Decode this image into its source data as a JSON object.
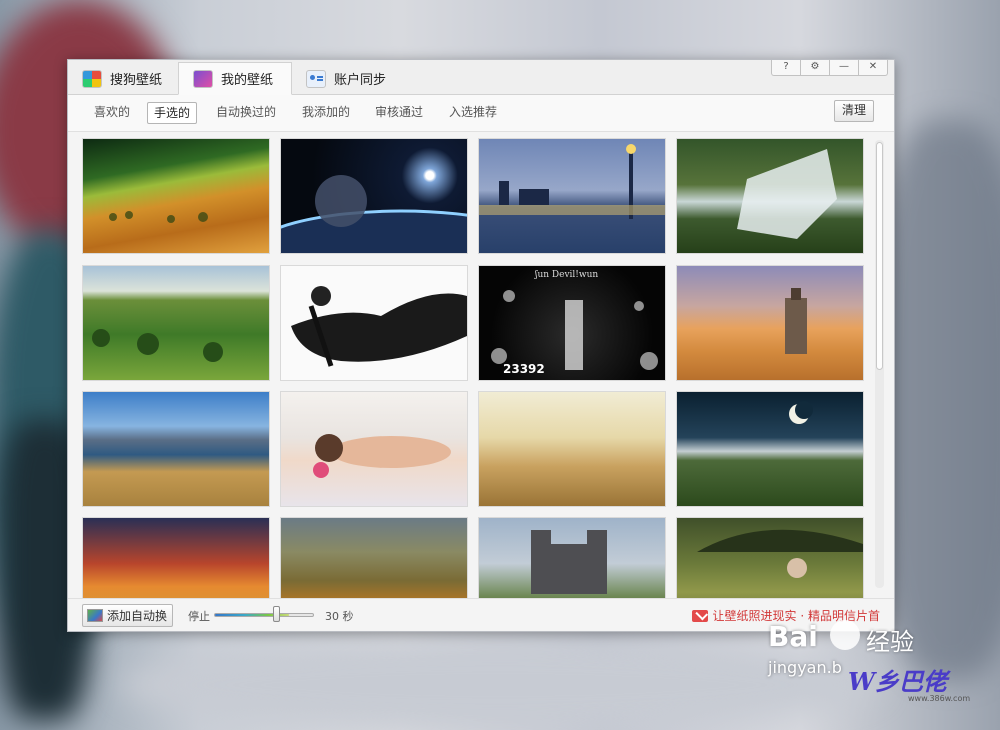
{
  "window": {
    "tabs": [
      {
        "label": "搜狗壁纸",
        "icon": "sogou-logo-icon",
        "active": false
      },
      {
        "label": "我的壁纸",
        "icon": "my-wallpaper-icon",
        "active": true
      },
      {
        "label": "账户同步",
        "icon": "account-sync-icon",
        "active": false
      }
    ],
    "controls": [
      "?",
      "⚙",
      "—",
      "✕"
    ]
  },
  "subnav": {
    "items": [
      {
        "label": "喜欢的",
        "active": false
      },
      {
        "label": "手选的",
        "active": true
      },
      {
        "label": "自动换过的",
        "active": false
      },
      {
        "label": "我添加的",
        "active": false
      },
      {
        "label": "审核通过",
        "active": false
      },
      {
        "label": "入选推荐",
        "active": false
      }
    ],
    "clear_label": "清理"
  },
  "thumbnails": [
    {
      "name": "wallpaper-golden-hills"
    },
    {
      "name": "wallpaper-space-planet"
    },
    {
      "name": "wallpaper-river-city-night"
    },
    {
      "name": "wallpaper-waterfall"
    },
    {
      "name": "wallpaper-green-meadow"
    },
    {
      "name": "wallpaper-anime-sketch"
    },
    {
      "name": "wallpaper-anime-dark",
      "caption_top": "ʃun Devil!wun",
      "caption_bottom": "23392"
    },
    {
      "name": "wallpaper-desert-lighthouse"
    },
    {
      "name": "wallpaper-lake-mountains"
    },
    {
      "name": "wallpaper-sleeping-girl"
    },
    {
      "name": "wallpaper-wheat-field"
    },
    {
      "name": "wallpaper-moon-night"
    },
    {
      "name": "wallpaper-sunset-clouds"
    },
    {
      "name": "wallpaper-autumn-valley"
    },
    {
      "name": "wallpaper-castle"
    },
    {
      "name": "wallpaper-umbrella-girl"
    }
  ],
  "footer": {
    "add_auto_label": "添加自动换",
    "stop_label": "停止",
    "seconds_label": "30 秒",
    "slider_level": 0.62,
    "promo_text": "让壁纸照进现实 · 精品明信片首"
  },
  "watermark": {
    "baidu": "Bai",
    "jingyan": "经验",
    "url": "jingyan.b",
    "brand": "W乡巴佬",
    "brand_url": "www.386w.com"
  }
}
